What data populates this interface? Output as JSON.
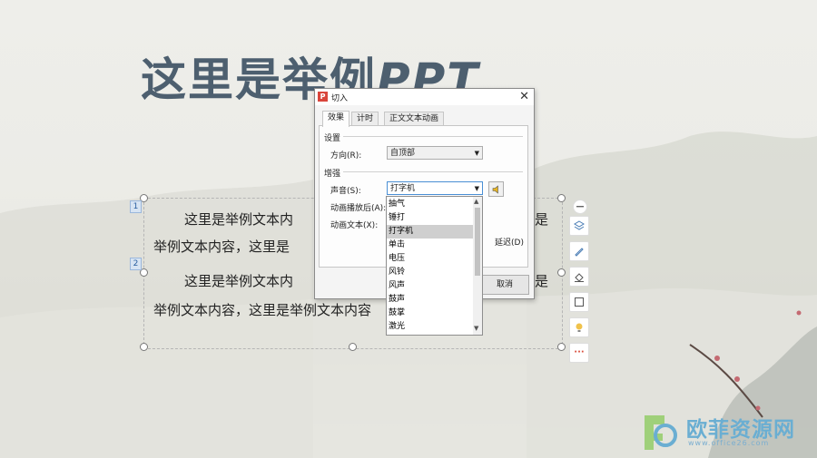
{
  "slide": {
    "title_cn": "这里是举例",
    "title_ppt": "PPT",
    "paragraph_numbers": [
      "1",
      "2"
    ],
    "para1_visible": "这里是举例文本内",
    "para1_right": "是",
    "para1_line2": "举例文本内容，这里是",
    "para2_visible": "这里是举例文本内",
    "para2_right": "是",
    "para2_line2": "举例文本内容，这里是举例文本内容"
  },
  "dialog": {
    "title": "切入",
    "close": "✕",
    "tabs": [
      "效果",
      "计时",
      "正文文本动画"
    ],
    "settings_group": "设置",
    "direction_label": "方向(R):",
    "direction_value": "自顶部",
    "enhance_group": "增强",
    "sound_label": "声音(S):",
    "sound_value": "打字机",
    "after_anim_label": "动画播放后(A):",
    "anim_text_label": "动画文本(X):",
    "partial_delay_text": "延迟(D)",
    "cancel_button": "取消"
  },
  "sound_options": [
    "抽气",
    "锤打",
    "打字机",
    "单击",
    "电压",
    "风铃",
    "风声",
    "鼓声",
    "鼓掌",
    "激光"
  ],
  "selected_sound_index": 2,
  "watermark": {
    "text": "欧菲资源网",
    "url": "www.office26.com"
  },
  "colors": {
    "title": "#4d5f6f",
    "logo_red": "#d9453b",
    "selection_blue": "#4a8fd4"
  }
}
